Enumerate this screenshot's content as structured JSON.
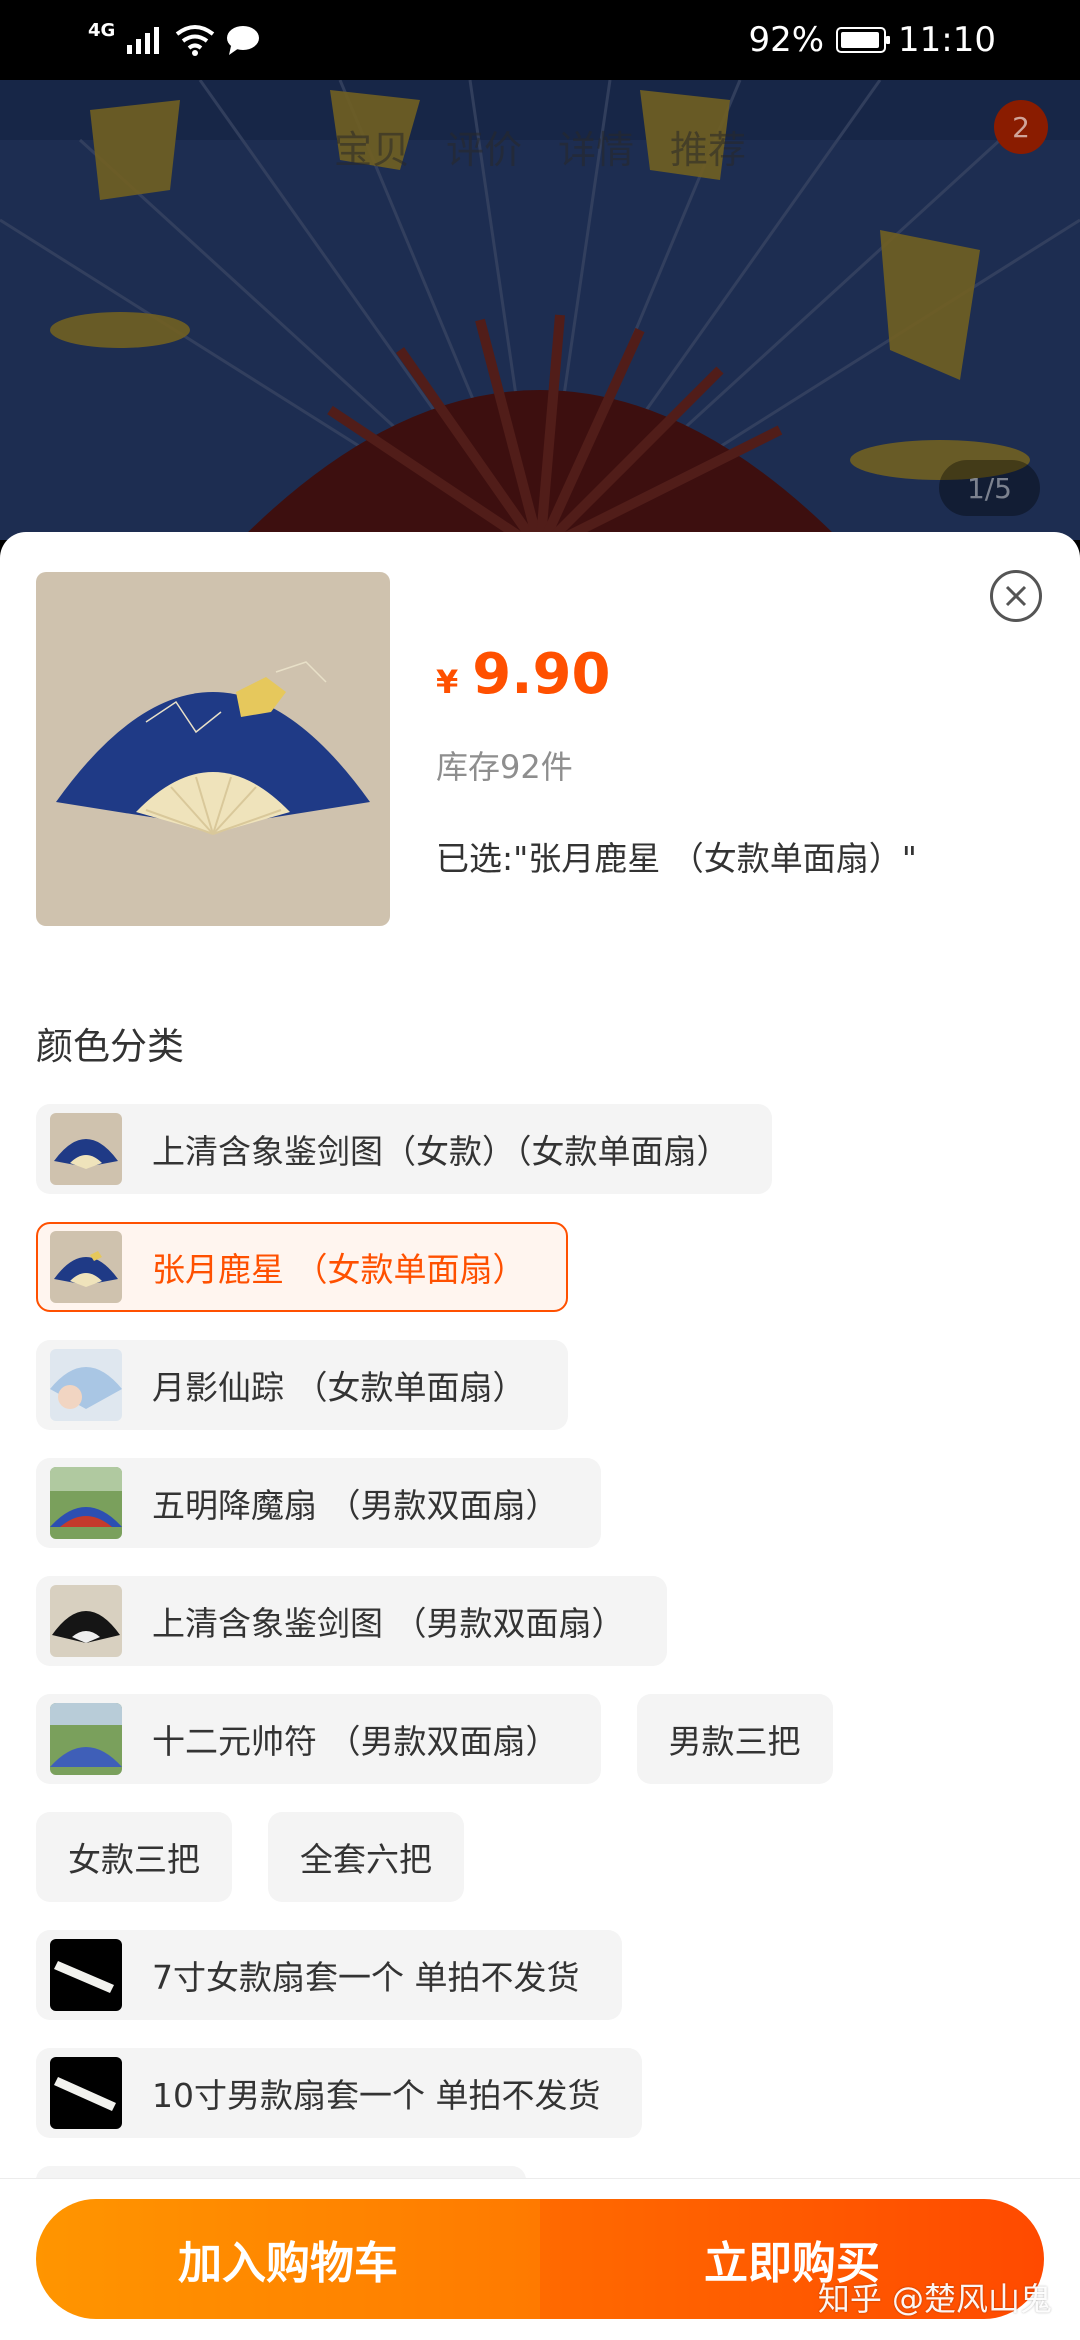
{
  "status_bar": {
    "network": "4G",
    "battery": "92%",
    "time": "11:10"
  },
  "background_page": {
    "tabs": [
      "宝贝",
      "评价",
      "详情",
      "推荐"
    ],
    "cart_badge": "2",
    "image_indicator": "1/5"
  },
  "sheet": {
    "price_symbol": "¥",
    "price": "9.90",
    "stock": "库存92件",
    "selected": "已选:\"张月鹿星 （女款单面扇）\"",
    "section_title": "颜色分类",
    "options": [
      {
        "label": "上清含象鉴剑图（女款）（女款单面扇）",
        "thumb": "blue-fan-icon"
      },
      {
        "label": "张月鹿星 （女款单面扇）",
        "thumb": "blue-fan-icon",
        "selected": true
      },
      {
        "label": "月影仙踪 （女款单面扇）",
        "thumb": "light-blue-fan-icon"
      },
      {
        "label": "五明降魔扇 （男款双面扇）",
        "thumb": "outdoor-fan-icon"
      },
      {
        "label": "上清含象鉴剑图 （男款双面扇）",
        "thumb": "black-fan-icon"
      },
      {
        "label": "十二元帅符 （男款双面扇）",
        "thumb": "outdoor-fan-icon"
      },
      {
        "label": "男款三把"
      },
      {
        "label": "女款三把"
      },
      {
        "label": "全套六把"
      },
      {
        "label": "7寸女款扇套一个 单拍不发货",
        "thumb": "fan-sleeve-icon"
      },
      {
        "label": "10寸男款扇套一个 单拍不发货",
        "thumb": "fan-sleeve-icon"
      }
    ]
  },
  "actions": {
    "add_to_cart": "加入购物车",
    "buy_now": "立即购买"
  },
  "watermark": "知乎 @楚风山鬼",
  "colors": {
    "accent": "#ff5000",
    "cart_button": "#ff8c00",
    "buy_button": "#ff5a00"
  }
}
